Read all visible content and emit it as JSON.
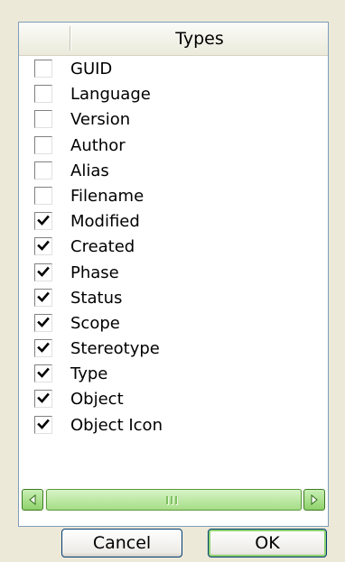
{
  "list": {
    "header_title": "Types",
    "items": [
      {
        "label": "GUID",
        "checked": false
      },
      {
        "label": "Language",
        "checked": false
      },
      {
        "label": "Version",
        "checked": false
      },
      {
        "label": "Author",
        "checked": false
      },
      {
        "label": "Alias",
        "checked": false
      },
      {
        "label": "Filename",
        "checked": false
      },
      {
        "label": "Modified",
        "checked": true
      },
      {
        "label": "Created",
        "checked": true
      },
      {
        "label": "Phase",
        "checked": true
      },
      {
        "label": "Status",
        "checked": true
      },
      {
        "label": "Scope",
        "checked": true
      },
      {
        "label": "Stereotype",
        "checked": true
      },
      {
        "label": "Type",
        "checked": true
      },
      {
        "label": "Object",
        "checked": true
      },
      {
        "label": "Object Icon",
        "checked": true
      }
    ]
  },
  "scrollbar": {
    "left_icon": "chevron-left-icon",
    "right_icon": "chevron-right-icon"
  },
  "buttons": {
    "cancel_label": "Cancel",
    "ok_label": "OK"
  },
  "colors": {
    "window_background": "#ece9d8",
    "list_border": "#7f9db9",
    "scrollbar_green": "#8fd26b",
    "button_border": "#003c74"
  }
}
